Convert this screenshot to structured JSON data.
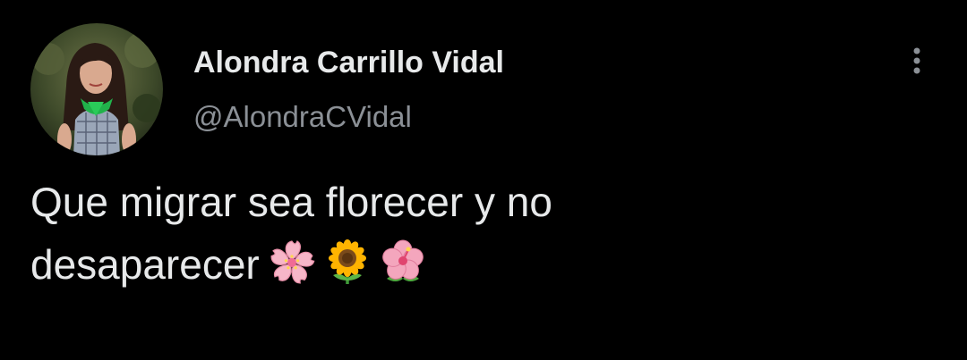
{
  "author": {
    "display_name": "Alondra Carrillo Vidal",
    "handle": "@AlondraCVidal"
  },
  "tweet": {
    "line1": "Que migrar sea florecer y no",
    "line2": "desaparecer"
  },
  "emojis": [
    "cherry-blossom",
    "sunflower",
    "hibiscus"
  ],
  "menu": {
    "icon": "more-options-icon"
  },
  "colors": {
    "background": "#000000",
    "text_primary": "#e7e9ea",
    "text_secondary": "#8b9096"
  }
}
